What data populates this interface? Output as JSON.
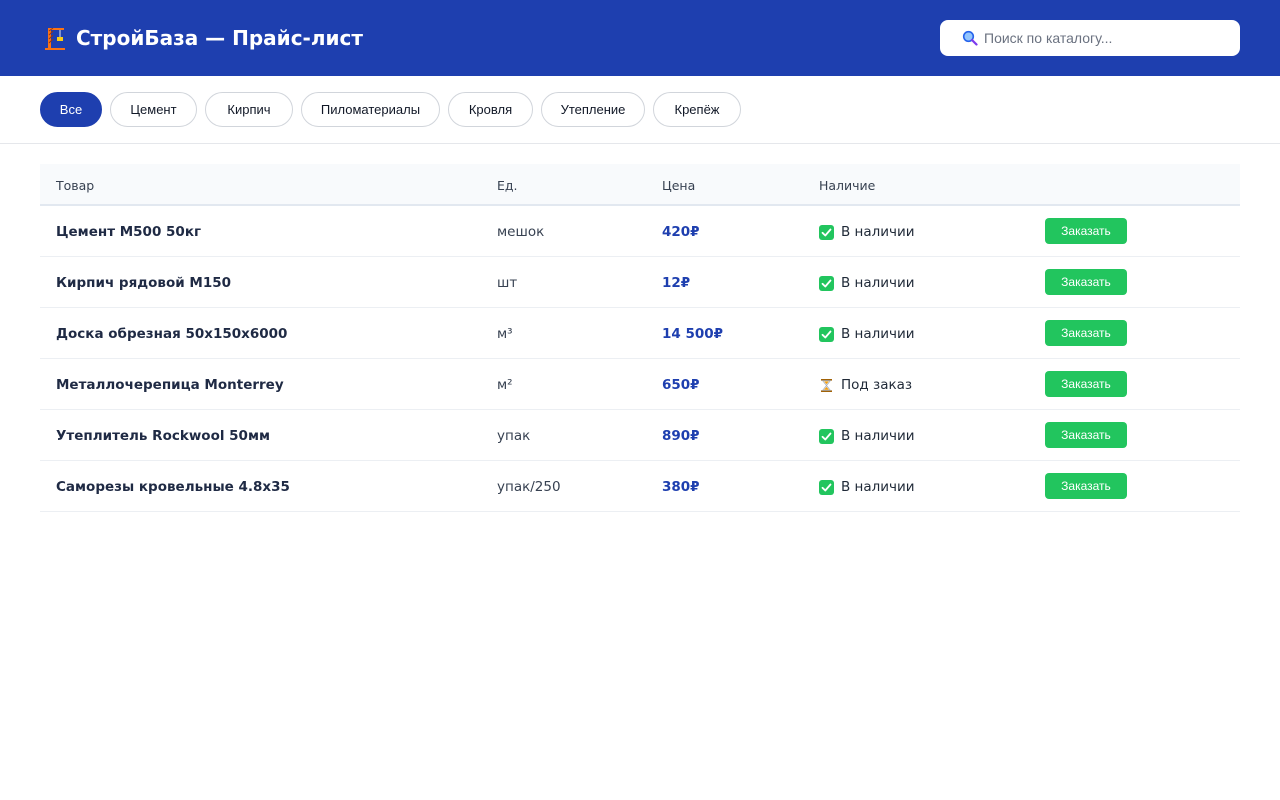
{
  "header": {
    "logo_icon": "construction-crane-icon",
    "title": "СтройБаза — Прайс-лист",
    "accent_color": "#1e3faf"
  },
  "search": {
    "icon": "search-icon",
    "placeholder": "Поиск по каталогу...",
    "value": ""
  },
  "filters": {
    "items": [
      {
        "label": "Все",
        "active": true
      },
      {
        "label": "Цемент",
        "active": false
      },
      {
        "label": "Кирпич",
        "active": false
      },
      {
        "label": "Пиломатериалы",
        "active": false
      },
      {
        "label": "Кровля",
        "active": false
      },
      {
        "label": "Утепление",
        "active": false
      },
      {
        "label": "Крепёж",
        "active": false
      }
    ]
  },
  "table": {
    "columns": [
      "Товар",
      "Ед.",
      "Цена",
      "Наличие",
      ""
    ],
    "rows": [
      {
        "name": "Цемент М500 50кг",
        "unit": "мешок",
        "price": "420₽",
        "stock": "В наличии",
        "stock_icon": "check-icon",
        "action": "Заказать"
      },
      {
        "name": "Кирпич рядовой М150",
        "unit": "шт",
        "price": "12₽",
        "stock": "В наличии",
        "stock_icon": "check-icon",
        "action": "Заказать"
      },
      {
        "name": "Доска обрезная 50x150x6000",
        "unit": "м³",
        "price": "14 500₽",
        "stock": "В наличии",
        "stock_icon": "check-icon",
        "action": "Заказать"
      },
      {
        "name": "Металлочерепица Monterrey",
        "unit": "м²",
        "price": "650₽",
        "stock": "Под заказ",
        "stock_icon": "hourglass-icon",
        "action": "Заказать"
      },
      {
        "name": "Утеплитель Rockwool 50мм",
        "unit": "упак",
        "price": "890₽",
        "stock": "В наличии",
        "stock_icon": "check-icon",
        "action": "Заказать"
      },
      {
        "name": "Саморезы кровельные 4.8x35",
        "unit": "упак/250",
        "price": "380₽",
        "stock": "В наличии",
        "stock_icon": "check-icon",
        "action": "Заказать"
      }
    ]
  },
  "colors": {
    "in_stock": "#22c55e",
    "order_button": "#22c55e",
    "price": "#1e3faf"
  }
}
